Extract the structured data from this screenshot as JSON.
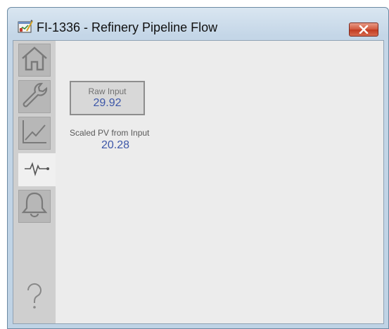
{
  "window": {
    "title": "FI-1336 - Refinery Pipeline Flow",
    "close_icon": "close-x-icon",
    "app_icon": "faceplate-icon"
  },
  "nav": {
    "items": [
      {
        "name": "home",
        "icon": "home-icon",
        "active": false
      },
      {
        "name": "maintenance",
        "icon": "wrench-icon",
        "active": false
      },
      {
        "name": "trends",
        "icon": "trend-chart-icon",
        "active": false
      },
      {
        "name": "diagnostics",
        "icon": "pulse-signal-icon",
        "active": true
      },
      {
        "name": "alarms",
        "icon": "bell-icon",
        "active": false
      },
      {
        "name": "help",
        "icon": "question-mark-icon",
        "active": false
      }
    ]
  },
  "raw_input": {
    "label": "Raw Input",
    "value": "29.92"
  },
  "scaled_pv": {
    "label": "Scaled PV from Input",
    "value": "20.28"
  },
  "colors": {
    "value_text": "#3d57a8",
    "panel_bg": "#ececec",
    "nav_bg": "#cfcfcf",
    "close_button": "#c0391f"
  }
}
